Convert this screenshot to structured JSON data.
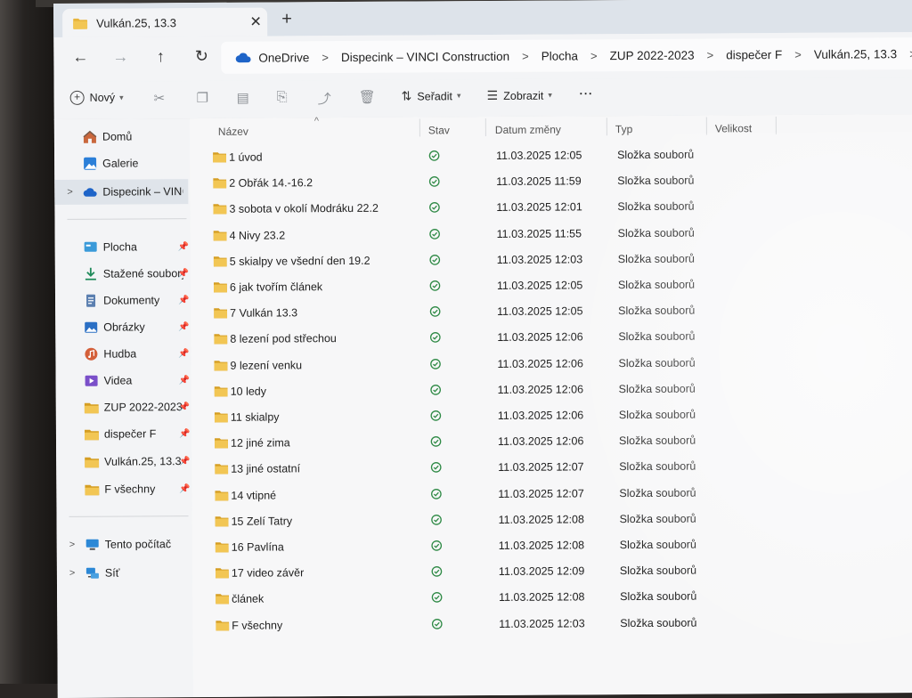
{
  "tab": {
    "title": "Vulkán.25, 13.3",
    "close": "✕",
    "new": "+"
  },
  "nav": {
    "back": "←",
    "forward": "→",
    "up": "↑",
    "refresh": "↻"
  },
  "breadcrumb": [
    "OneDrive",
    "Dispecink – VINCI Construction",
    "Plocha",
    "ZUP 2022-2023",
    "dispečer F",
    "Vulkán.25, 13.3"
  ],
  "breadcrumb_sep": ">",
  "toolbar": {
    "new": "Nový",
    "sort": "Seřadit",
    "view": "Zobrazit",
    "more": "···"
  },
  "sidebar": {
    "top": [
      {
        "label": "Domů"
      },
      {
        "label": "Galerie"
      },
      {
        "label": "Dispecink – VINCI Construction"
      }
    ],
    "quick": [
      {
        "label": "Plocha"
      },
      {
        "label": "Stažené soubory"
      },
      {
        "label": "Dokumenty"
      },
      {
        "label": "Obrázky"
      },
      {
        "label": "Hudba"
      },
      {
        "label": "Videa"
      },
      {
        "label": "ZUP 2022-2023"
      },
      {
        "label": "dispečer F"
      },
      {
        "label": "Vulkán.25, 13.3"
      },
      {
        "label": "F všechny"
      }
    ],
    "bottom": [
      {
        "label": "Tento počítač"
      },
      {
        "label": "Síť"
      }
    ],
    "expander": ">",
    "pin": "📌"
  },
  "columns": {
    "name": "Název",
    "status": "Stav",
    "date": "Datum změny",
    "type": "Typ",
    "size": "Velikost"
  },
  "sort_indicator": "^",
  "files": [
    {
      "name": "1 úvod",
      "date": "11.03.2025 12:05",
      "type": "Složka souborů"
    },
    {
      "name": "2 Obřák 14.-16.2",
      "date": "11.03.2025 11:59",
      "type": "Složka souborů"
    },
    {
      "name": "3 sobota v okolí Modráku 22.2",
      "date": "11.03.2025 12:01",
      "type": "Složka souborů"
    },
    {
      "name": "4 Nivy 23.2",
      "date": "11.03.2025 11:55",
      "type": "Složka souborů"
    },
    {
      "name": "5 skialpy ve všední den 19.2",
      "date": "11.03.2025 12:03",
      "type": "Složka souborů"
    },
    {
      "name": "6 jak tvořím článek",
      "date": "11.03.2025 12:05",
      "type": "Složka souborů"
    },
    {
      "name": "7 Vulkán 13.3",
      "date": "11.03.2025 12:05",
      "type": "Složka souborů"
    },
    {
      "name": "8 lezení pod střechou",
      "date": "11.03.2025 12:06",
      "type": "Složka souborů"
    },
    {
      "name": "9 lezení venku",
      "date": "11.03.2025 12:06",
      "type": "Složka souborů"
    },
    {
      "name": "10 ledy",
      "date": "11.03.2025 12:06",
      "type": "Složka souborů"
    },
    {
      "name": "11 skialpy",
      "date": "11.03.2025 12:06",
      "type": "Složka souborů"
    },
    {
      "name": "12 jiné zima",
      "date": "11.03.2025 12:06",
      "type": "Složka souborů"
    },
    {
      "name": "13 jiné ostatní",
      "date": "11.03.2025 12:07",
      "type": "Složka souborů"
    },
    {
      "name": "14 vtipné",
      "date": "11.03.2025 12:07",
      "type": "Složka souborů"
    },
    {
      "name": "15 Zelí Tatry",
      "date": "11.03.2025 12:08",
      "type": "Složka souborů"
    },
    {
      "name": "16 Pavlína",
      "date": "11.03.2025 12:08",
      "type": "Složka souborů"
    },
    {
      "name": "17 video závěr",
      "date": "11.03.2025 12:09",
      "type": "Složka souborů"
    },
    {
      "name": "článek",
      "date": "11.03.2025 12:08",
      "type": "Složka souborů"
    },
    {
      "name": "F všechny",
      "date": "11.03.2025 12:03",
      "type": "Složka souborů"
    }
  ],
  "colors": {
    "folder": "#e8b53c",
    "folder_dark": "#d59e23",
    "status_ok": "#2f8a46",
    "onedrive": "#1e64c8",
    "selected": "#dfe4ea"
  }
}
